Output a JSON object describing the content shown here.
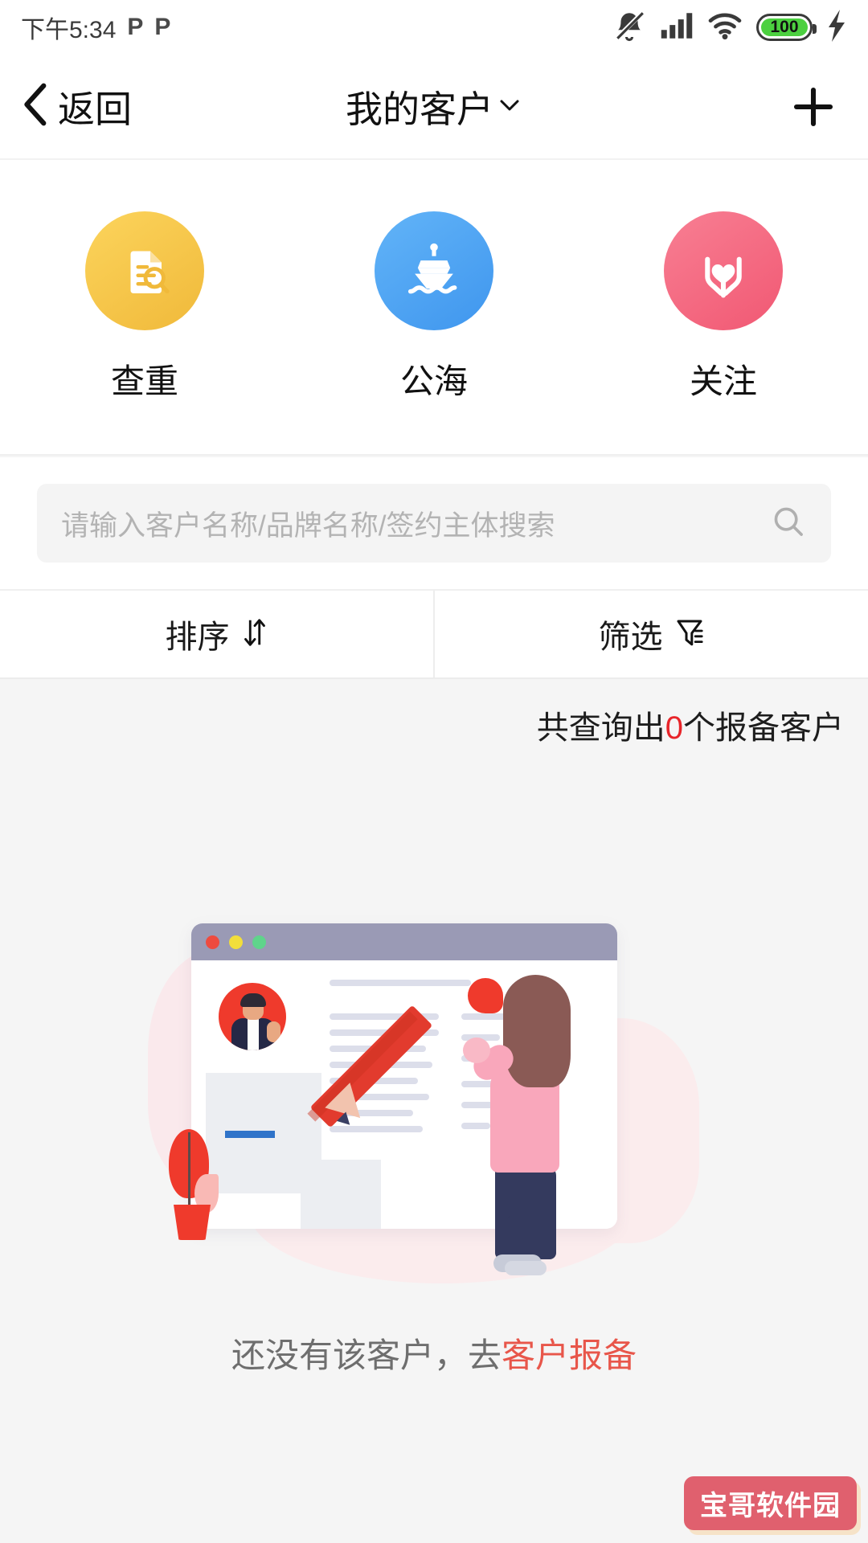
{
  "status_bar": {
    "time": "下午5:34",
    "app_badge_1": "P",
    "app_badge_2": "P",
    "mute_icon": "bell-muted-icon",
    "signal_icon": "cellular-signal-icon",
    "wifi_icon": "wifi-icon",
    "battery_level": "100",
    "charging_icon": "lightning-bolt-icon",
    "battery_color": "#4cd040"
  },
  "nav": {
    "back_label": "返回",
    "back_icon": "chevron-left-icon",
    "title": "我的客户",
    "title_caret": "chevron-down-icon",
    "add_icon": "plus-icon"
  },
  "quick_actions": [
    {
      "label": "查重",
      "icon": "document-search-icon",
      "color": "#f6c643"
    },
    {
      "label": "公海",
      "icon": "ship-icon",
      "color": "#4ea6f5"
    },
    {
      "label": "关注",
      "icon": "hands-heart-icon",
      "color": "#f4697f"
    }
  ],
  "search": {
    "placeholder": "请输入客户名称/品牌名称/签约主体搜索",
    "value": "",
    "icon": "search-icon"
  },
  "toolbar": {
    "sort_label": "排序",
    "sort_icon": "sort-arrows-icon",
    "filter_label": "筛选",
    "filter_icon": "funnel-icon"
  },
  "result_count": {
    "prefix": "共查询出",
    "count": "0",
    "suffix": "个报备客户",
    "count_color": "#e8252a"
  },
  "empty_state": {
    "text_prefix": "还没有该客户，去",
    "link_label": "客户报备",
    "link_color": "#e8564a",
    "illustration": "person-writing-with-pencil-illustration"
  },
  "watermark": {
    "label": "宝哥软件园",
    "color": "#e0606e"
  }
}
